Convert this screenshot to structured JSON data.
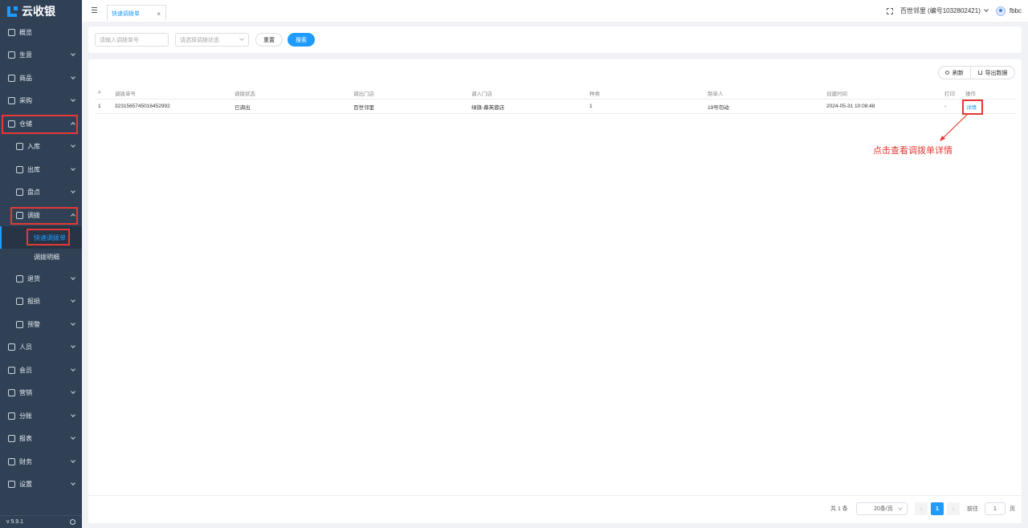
{
  "app": {
    "name": "云收银",
    "version": "v 5.9.1"
  },
  "sidebar": {
    "items": [
      {
        "label": "概览"
      },
      {
        "label": "生意"
      },
      {
        "label": "商品"
      },
      {
        "label": "采购"
      },
      {
        "label": "仓储"
      },
      {
        "label": "入库"
      },
      {
        "label": "出库"
      },
      {
        "label": "盘点"
      },
      {
        "label": "调拨"
      },
      {
        "label": "快速调拨单"
      },
      {
        "label": "调拨明细"
      },
      {
        "label": "退货"
      },
      {
        "label": "报损"
      },
      {
        "label": "预警"
      },
      {
        "label": "人员"
      },
      {
        "label": "会员"
      },
      {
        "label": "营销"
      },
      {
        "label": "分账"
      },
      {
        "label": "报表"
      },
      {
        "label": "财务"
      },
      {
        "label": "设置"
      }
    ]
  },
  "topbar": {
    "tab_label": "快速调拨单",
    "tab_close": "×",
    "shop": "百世邻里 (编号1032802421)",
    "user": "fbbc"
  },
  "search": {
    "order_placeholder": "请输入调拨单号",
    "status_placeholder": "请选择调拨状态",
    "reset_label": "重置",
    "search_label": "搜索"
  },
  "toolbar": {
    "refresh_label": "刷新",
    "export_label": "导出数据"
  },
  "table": {
    "columns": [
      "#",
      "调拨单号",
      "调拨状态",
      "调出门店",
      "调入门店",
      "种类",
      "制单人",
      "创建时间",
      "打印",
      "操作"
    ],
    "rows": [
      {
        "index": "1",
        "order_no": "3231565745016452992",
        "status": "已调出",
        "from_store": "百世邻里",
        "to_store": "绿旗-幕芙蓉店",
        "kinds": "1",
        "creator": "19号勿动",
        "created_at": "2024-05-31 10:08:48",
        "print": "-",
        "action": "详情"
      }
    ]
  },
  "annotation": {
    "text": "点击查看调拨单详情",
    "color": "#e53935"
  },
  "pagination": {
    "total": "共 1 条",
    "page_size": "20条/页",
    "prev": "‹",
    "current": "1",
    "next": "›",
    "goto_label": "前往",
    "goto_value": "1",
    "page_unit": "页"
  },
  "colors": {
    "accent": "#1f9bff",
    "sidebar": "#304156",
    "highlight": "#e53935"
  }
}
